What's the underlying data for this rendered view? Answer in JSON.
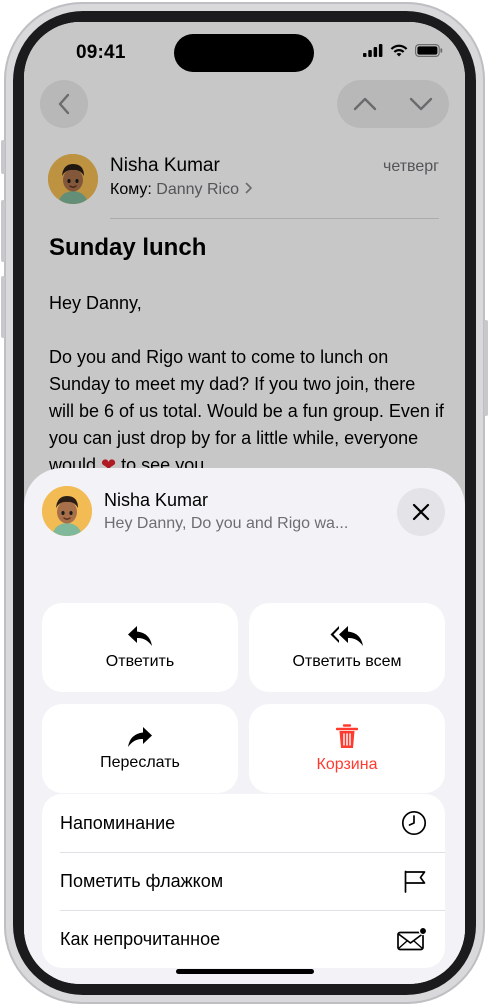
{
  "status_bar": {
    "time": "09:41"
  },
  "mail": {
    "sender": "Nisha Kumar",
    "recipient_prefix": "Кому:",
    "recipient": "Danny Rico",
    "date": "четверг",
    "subject": "Sunday lunch",
    "greeting": "Hey Danny,",
    "body_line1": "Do you and Rigo want to come to lunch on Sunday to meet my dad? If you two join, there will be 6 of us total. Would be a fun group. Even if you can just drop by for a little while, everyone would",
    "body_line2": "to see you."
  },
  "sheet": {
    "sender": "Nisha Kumar",
    "preview": "Hey Danny, Do you and Rigo wa...",
    "actions": {
      "reply": "Ответить",
      "reply_all": "Ответить всем",
      "forward": "Переслать",
      "trash": "Корзина"
    },
    "list": {
      "remind": "Напоминание",
      "flag": "Пометить флажком",
      "unread": "Как непрочитанное"
    }
  },
  "colors": {
    "accent_red": "#ff3b30",
    "sheet_bg": "#f2f2f7",
    "avatar_bg": "#f3bb54"
  },
  "icons": [
    "back-chevron-icon",
    "chevron-up-icon",
    "chevron-down-icon",
    "close-icon",
    "reply-icon",
    "reply-all-icon",
    "forward-icon",
    "trash-icon",
    "clock-icon",
    "flag-icon",
    "envelope-unread-icon"
  ]
}
